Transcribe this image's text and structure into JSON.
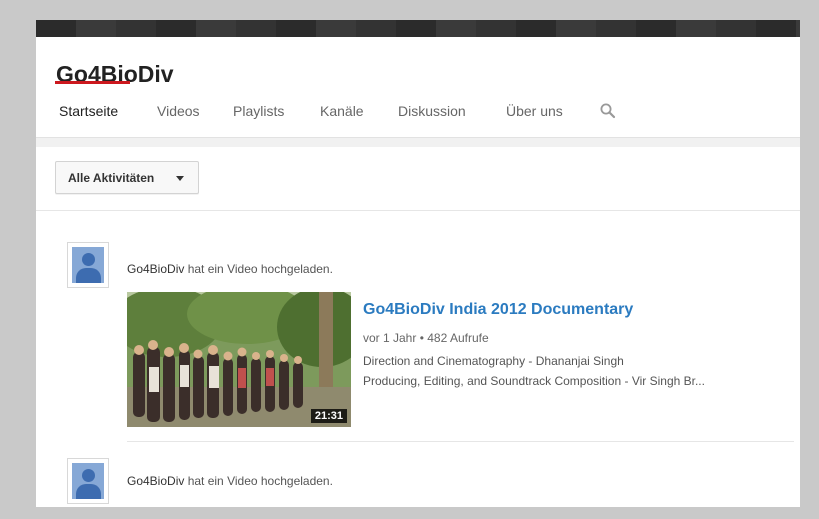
{
  "channel": {
    "title": "Go4BioDiv"
  },
  "tabs": [
    {
      "label": "Startseite",
      "active": true
    },
    {
      "label": "Videos"
    },
    {
      "label": "Playlists"
    },
    {
      "label": "Kanäle"
    },
    {
      "label": "Diskussion"
    },
    {
      "label": "Über uns"
    }
  ],
  "filter": {
    "label": "Alle Aktivitäten"
  },
  "feed": [
    {
      "user": "Go4BioDiv",
      "action": "hat ein Video hochgeladen.",
      "video": {
        "title": "Go4BioDiv India 2012 Documentary",
        "age": "vor 1 Jahr",
        "views": "482 Aufrufe",
        "duration": "21:31",
        "desc_line1": "Direction and Cinematography - Dhananjai Singh",
        "desc_line2": "Producing, Editing, and Soundtrack Composition - Vir Singh Br..."
      }
    },
    {
      "user": "Go4BioDiv",
      "action": "hat ein Video hochgeladen."
    }
  ],
  "icons": {
    "search": "search-icon",
    "caret": "caret-down-icon",
    "avatar": "user-avatar-icon"
  },
  "colors": {
    "active_tab_underline": "#cc181e",
    "link": "#2b7bc0"
  }
}
